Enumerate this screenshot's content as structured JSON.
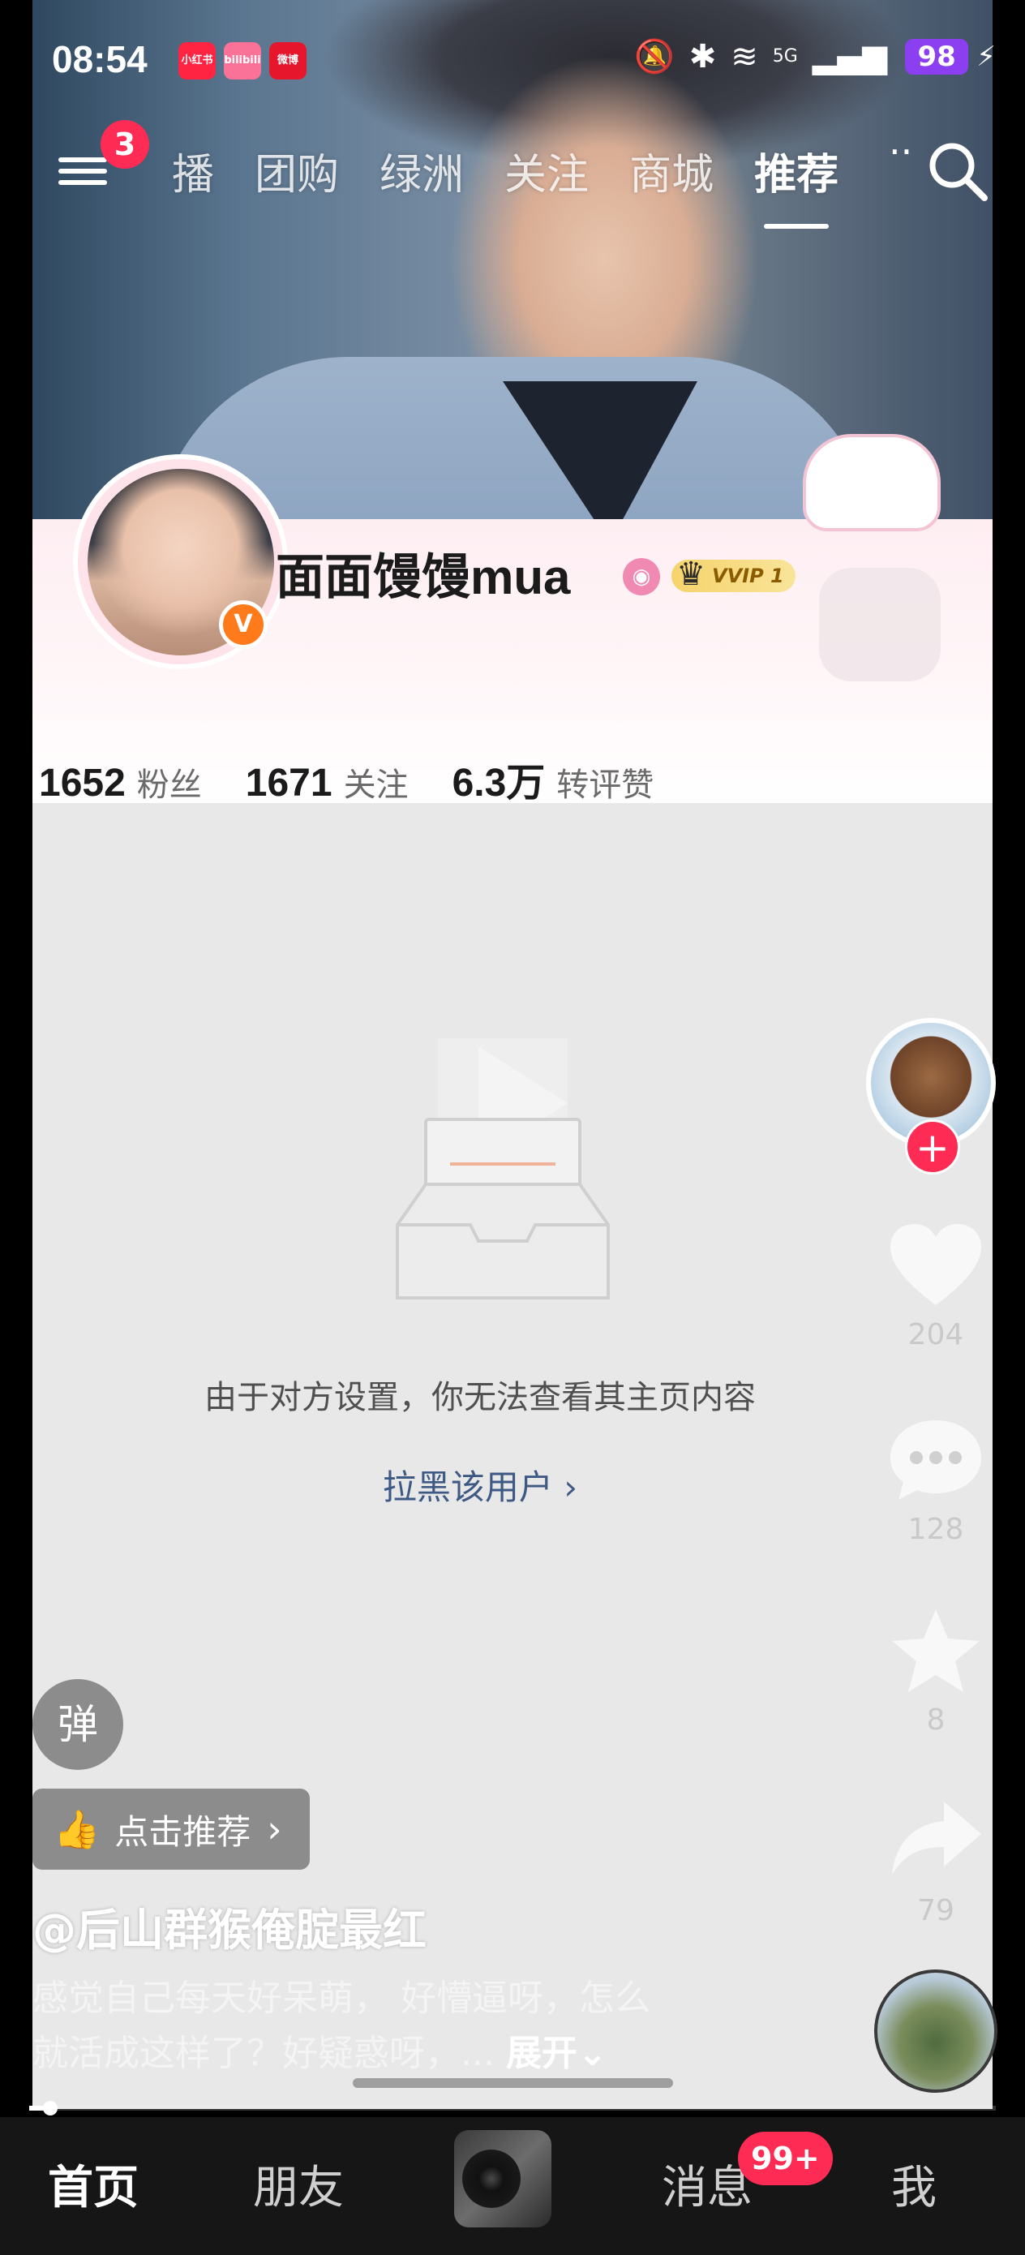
{
  "status_bar": {
    "time": "08:54",
    "app_badges": [
      "小红书",
      "bilibili",
      "微博"
    ],
    "battery": "98",
    "network": "5G"
  },
  "top_nav": {
    "menu_badge": "3",
    "tabs": [
      {
        "label": "播",
        "active": false
      },
      {
        "label": "团购",
        "active": false
      },
      {
        "label": "绿洲",
        "active": false
      },
      {
        "label": "关注",
        "active": false
      },
      {
        "label": "商城",
        "active": false
      },
      {
        "label": "推荐",
        "active": true
      }
    ],
    "icons": [
      "menu-icon",
      "search-icon"
    ]
  },
  "profile": {
    "nickname": "面面馒馒mua",
    "verified_mark": "V",
    "vip_label": "VVIP 1",
    "stats": [
      {
        "value": "1652",
        "label": "粉丝"
      },
      {
        "value": "1671",
        "label": "关注"
      },
      {
        "value": "6.3万",
        "label": "转评赞"
      }
    ]
  },
  "empty_state": {
    "message": "由于对方设置，你无法查看其主页内容",
    "block_link": "拉黑该用户 ›"
  },
  "actions": {
    "follow_plus": "+",
    "like_count": "204",
    "comment_count": "128",
    "favorite_count": "8",
    "share_count": "79"
  },
  "overlay": {
    "danmu_label": "弹",
    "recommend_label": "点击推荐",
    "author": "@后山群猴俺腚最红",
    "caption_line1": "感觉自己每天好呆萌， 好懵逼呀，怎么",
    "caption_line2": "就活成这样了？好疑惑呀，...",
    "expand_label": "展开",
    "progress": 0.022
  },
  "tab_bar": {
    "home": "首页",
    "friends": "朋友",
    "messages": "消息",
    "messages_badge": "99+",
    "me": "我"
  },
  "colors": {
    "accent_red": "#fe2c55",
    "link_blue": "#3e5a84",
    "vip_gold": "#f6d36b",
    "battery_purple": "#8b3ff0"
  }
}
